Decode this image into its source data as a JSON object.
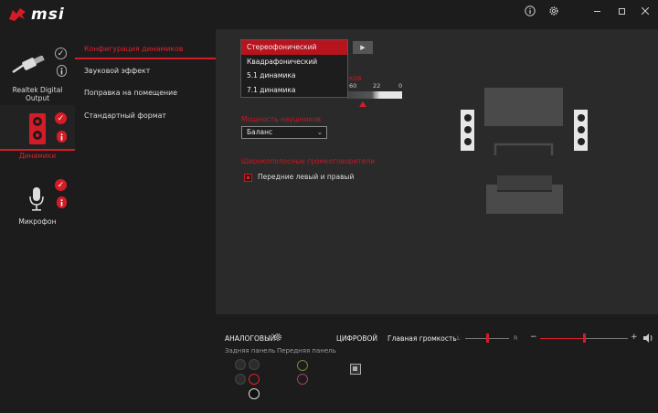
{
  "brand": {
    "name": "msi"
  },
  "window": {
    "icons": [
      "info-icon",
      "gear-icon",
      "minimize-icon",
      "maximize-icon",
      "close-icon"
    ]
  },
  "devices": [
    {
      "label": "Realtek Digital Output",
      "icon": "digital-cable-icon",
      "active": false
    },
    {
      "label": "Динамики",
      "icon": "speaker-icon",
      "active": true
    },
    {
      "label": "Микрофон",
      "icon": "microphone-icon",
      "active": false
    }
  ],
  "submenu": {
    "items": [
      "Конфигурация динамиков",
      "Звуковой эффект",
      "Поправка на помещение",
      "Стандартный формат"
    ],
    "active_index": 0
  },
  "config": {
    "dropdown_options": [
      "Стереофонический",
      "Квадрафонический",
      "5.1 динамика",
      "7.1 динамика"
    ],
    "selected_index": 0,
    "partial_label": "ков",
    "scale_labels": [
      "60",
      "22",
      "0"
    ],
    "headphone_label": "Мощность наушников",
    "balance_value": "Баланс",
    "wideband_label": "Широкополосные громкоговорители",
    "front_lr_label": "Передние левый и правый",
    "front_lr_checked": true
  },
  "analog": {
    "title": "АНАЛОГОВЫЙ",
    "rear_panel": "Задняя панель",
    "front_panel": "Передняя панель",
    "digital_title": "ЦИФРОВОЙ",
    "colors": {
      "active_port": "#e0202a",
      "front_green": "#6a8a3a",
      "front_pink": "#a0406a"
    }
  },
  "volume": {
    "label": "Главная громкость",
    "left": "L",
    "right": "R",
    "minus": "−",
    "plus": "+",
    "balance_pct": 50,
    "level_pct": 50
  },
  "colors": {
    "accent": "#d41c28",
    "bg": "#2a2a2a",
    "panel": "#1c1c1c"
  }
}
